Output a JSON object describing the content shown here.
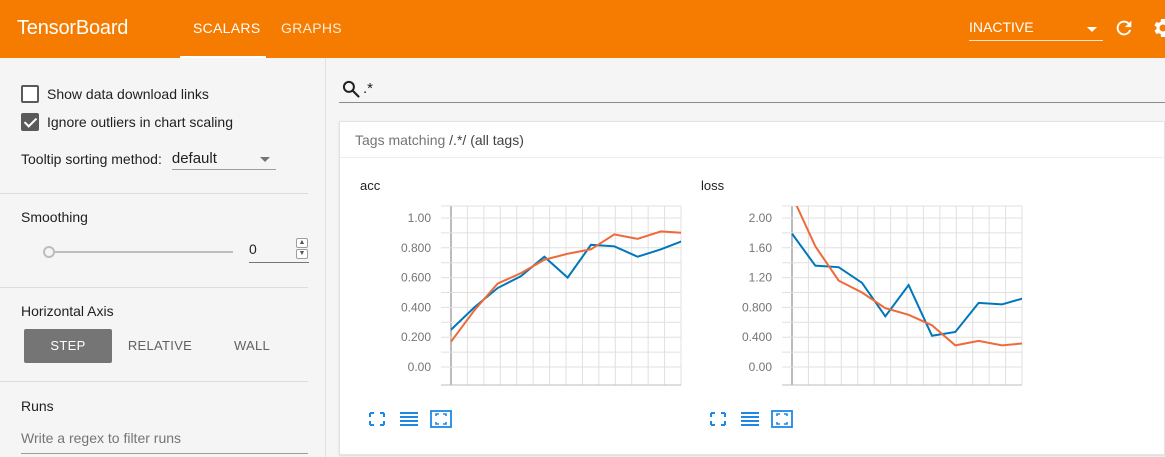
{
  "header": {
    "brand": "TensorBoard",
    "tabs": [
      {
        "label": "SCALARS",
        "active": true
      },
      {
        "label": "GRAPHS",
        "active": false
      }
    ],
    "run_status": "INACTIVE",
    "colors": {
      "bar": "#f57c00",
      "text": "#ffffff"
    },
    "icons": [
      "reload-icon",
      "settings-icon"
    ]
  },
  "sidebar": {
    "show_download_links": {
      "label": "Show data download links",
      "checked": false
    },
    "ignore_outliers": {
      "label": "Ignore outliers in chart scaling",
      "checked": true
    },
    "tooltip_sorting": {
      "label": "Tooltip sorting method:",
      "value": "default"
    },
    "smoothing": {
      "title": "Smoothing",
      "value": "0",
      "level": 0
    },
    "horizontal_axis": {
      "title": "Horizontal Axis",
      "options": [
        "STEP",
        "RELATIVE",
        "WALL"
      ],
      "selected": "STEP"
    },
    "runs": {
      "title": "Runs",
      "filter_placeholder": "Write a regex to filter runs"
    }
  },
  "main": {
    "search": {
      "value": ".*",
      "icon": "search-icon"
    },
    "card": {
      "prefix": "Tags matching",
      "pattern": "/.*/",
      "suffix": "(all tags)"
    }
  },
  "chart_data": [
    {
      "type": "line",
      "title": "acc",
      "x": [
        0,
        1,
        2,
        3,
        4,
        5,
        6,
        7,
        8,
        9,
        10,
        11,
        12,
        13
      ],
      "ylim": [
        0.0,
        1.0
      ],
      "y_ticks": [
        "1.00",
        "0.800",
        "0.600",
        "0.400",
        "0.200",
        "0.00"
      ],
      "grid": true,
      "series": [
        {
          "color": "#0077bb",
          "values": [
            0.25,
            0.4,
            0.53,
            0.61,
            0.74,
            0.6,
            0.82,
            0.81,
            0.74,
            0.79,
            0.85,
            0.86
          ]
        },
        {
          "color": "#ee6a3a",
          "values": [
            0.17,
            0.38,
            0.56,
            0.63,
            0.72,
            0.76,
            0.79,
            0.89,
            0.86,
            0.91,
            0.9,
            0.93
          ]
        }
      ]
    },
    {
      "type": "line",
      "title": "loss",
      "ylim": [
        0.0,
        2.0
      ],
      "y_ticks": [
        "2.00",
        "1.60",
        "1.20",
        "0.800",
        "0.400",
        "0.00"
      ],
      "grid": true,
      "series": [
        {
          "color": "#0077bb",
          "values": [
            1.79,
            1.36,
            1.34,
            1.13,
            0.68,
            1.1,
            0.42,
            0.47,
            0.86,
            0.84,
            0.93,
            0.41
          ]
        },
        {
          "color": "#ee6a3a",
          "values": [
            2.3,
            1.62,
            1.16,
            1.0,
            0.79,
            0.7,
            0.56,
            0.29,
            0.35,
            0.29,
            0.32,
            0.23
          ]
        }
      ]
    }
  ]
}
